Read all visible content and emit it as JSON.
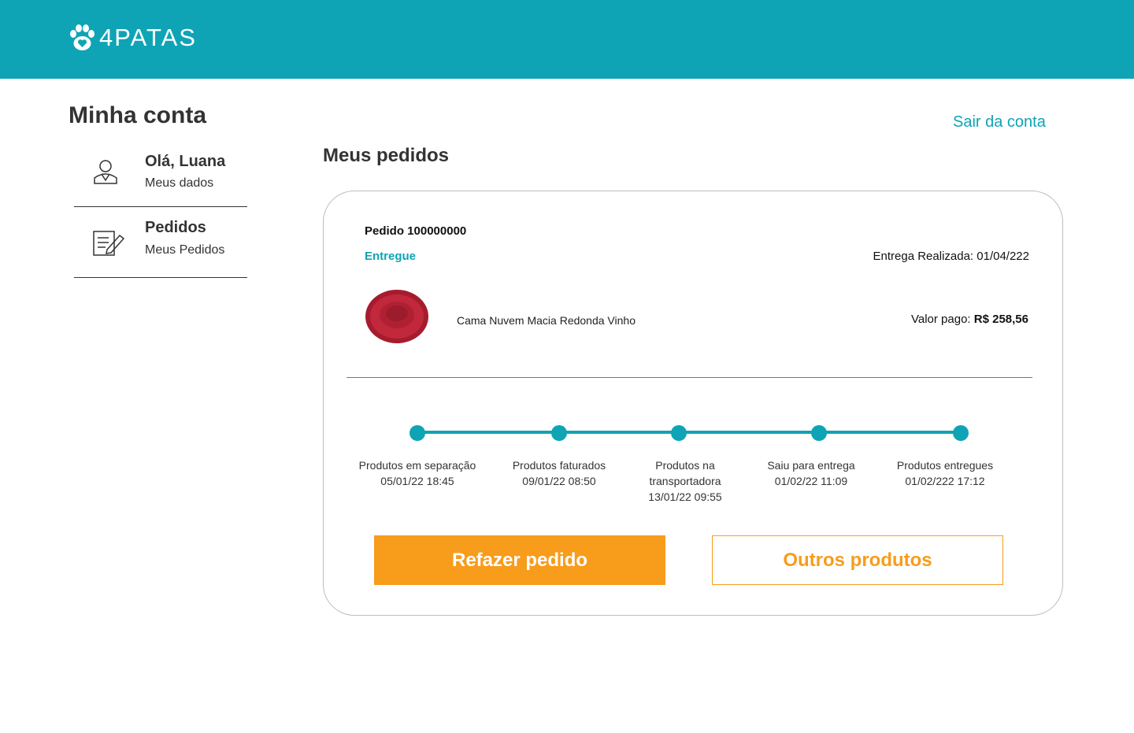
{
  "header": {
    "logo_text": "4PATAS",
    "logo_icon": "paw-heart-icon",
    "background": "#0ea4b6"
  },
  "account": {
    "title": "Minha conta",
    "logout": "Sair da conta"
  },
  "sidebar": {
    "items": [
      {
        "title": "Olá, Luana",
        "subtitle": "Meus dados",
        "icon": "user-icon"
      },
      {
        "title": "Pedidos",
        "subtitle": "Meus Pedidos",
        "icon": "order-edit-icon"
      }
    ]
  },
  "orders": {
    "title": "Meus pedidos",
    "order": {
      "number": "Pedido 100000000",
      "status": "Entregue",
      "delivery": "Entrega Realizada: 01/04/222",
      "product_name": "Cama Nuvem Macia Redonda Vinho",
      "paid_label": "Valor pago:",
      "paid_value": "R$ 258,56",
      "tracking": [
        {
          "lines": [
            "Produtos em separação",
            "05/01/22 18:45"
          ]
        },
        {
          "lines": [
            "Produtos faturados",
            "09/01/22 08:50"
          ]
        },
        {
          "lines": [
            "Produtos na",
            "transportadora",
            "13/01/22 09:55"
          ]
        },
        {
          "lines": [
            "Saiu para entrega",
            "01/02/22 11:09"
          ]
        },
        {
          "lines": [
            "Produtos entregues",
            "01/02/222 17:12"
          ]
        }
      ],
      "reorder_label": "Refazer pedido",
      "other_products_label": "Outros produtos"
    }
  },
  "colors": {
    "accent": "#0ea4b6",
    "button": "#f89c1c",
    "text": "#333333"
  }
}
